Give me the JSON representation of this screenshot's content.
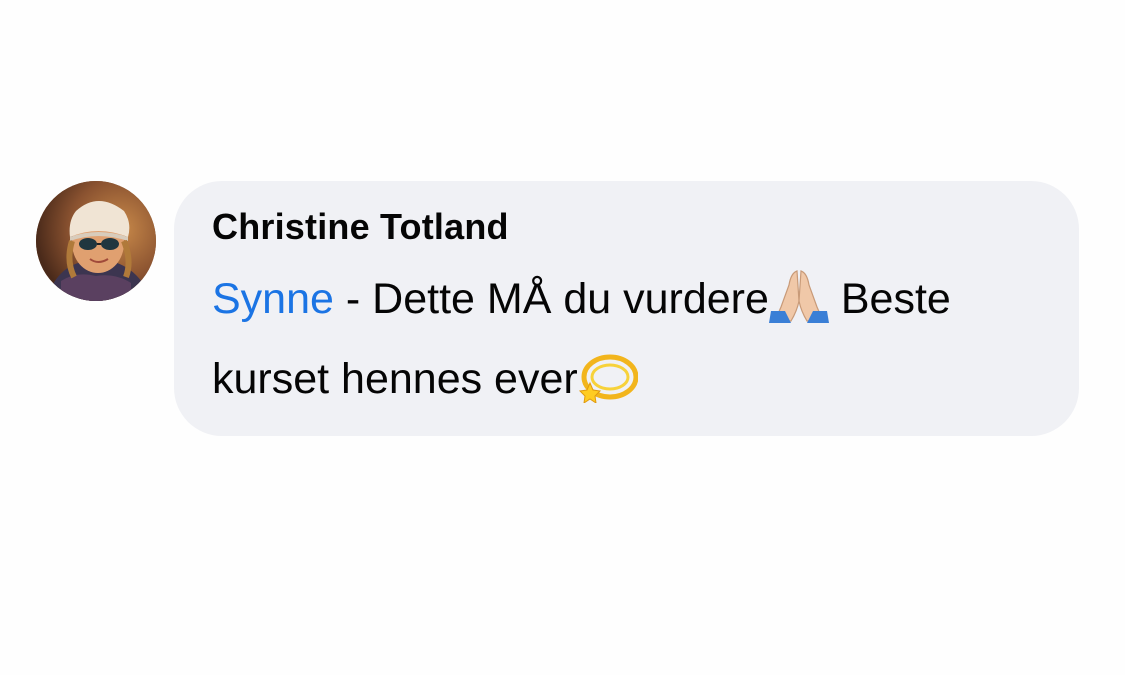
{
  "comment": {
    "author": "Christine Totland",
    "mention": "Synne",
    "text_part1": " - Dette MÅ du vurdere",
    "text_part2": " Beste kurset hennes ever",
    "emoji_1": "folded-hands",
    "emoji_2": "dizzy",
    "colors": {
      "bubble": "#f0f1f5",
      "mention": "#1b74e4",
      "text": "#050505"
    }
  }
}
